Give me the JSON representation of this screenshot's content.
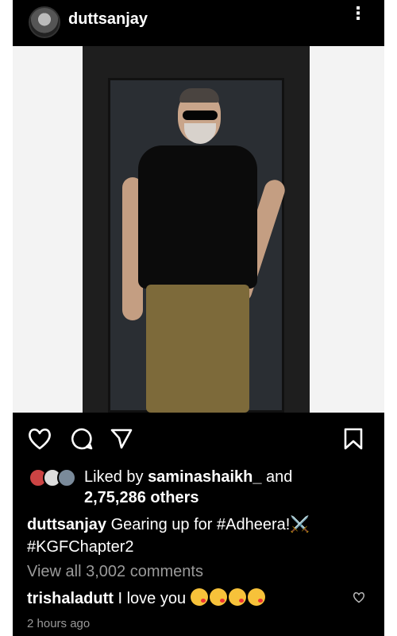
{
  "post": {
    "username": "duttsanjay",
    "more_icon": "⋮",
    "likes_prefix": "Liked by",
    "liked_by_user": "saminashaikh_",
    "likes_and": "and",
    "likes_others": "2,75,286 others",
    "caption_user": "duttsanjay",
    "caption_text_1": "Gearing up for #Adheera!",
    "caption_emoji": "⚔️",
    "caption_text_2": "#KGFChapter2",
    "view_comments": "View all 3,002 comments",
    "comment_user": "trishaladutt",
    "comment_text": "I love you",
    "timestamp": "2 hours ago"
  },
  "icons": {
    "like": "heart-icon",
    "comment": "comment-icon",
    "share": "share-icon",
    "save": "bookmark-icon"
  },
  "colors": {
    "background": "#000000",
    "text": "#ffffff",
    "muted": "#9a9a9a"
  }
}
